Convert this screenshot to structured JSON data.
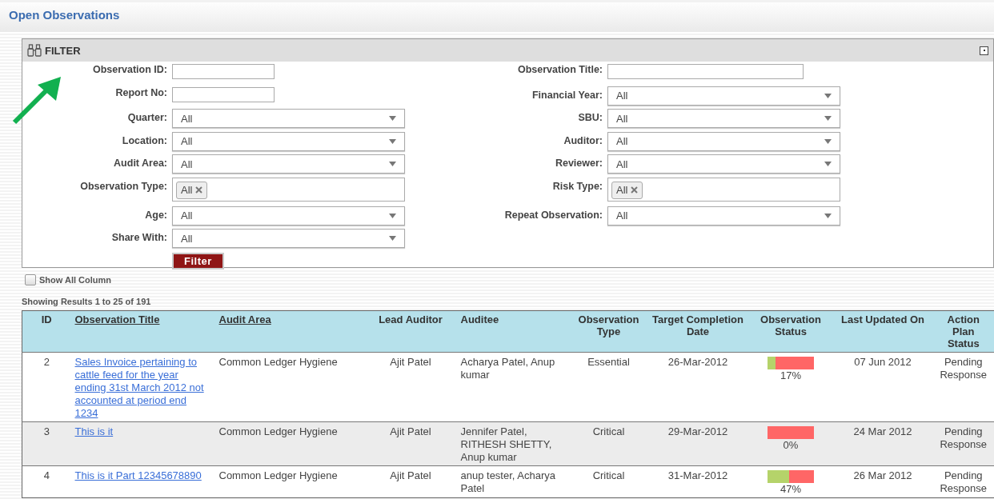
{
  "page": {
    "title": "Open Observations"
  },
  "filter": {
    "title": "FILTER",
    "left_fields": [
      {
        "label": "Observation ID:",
        "kind": "text"
      },
      {
        "label": "Report No:",
        "kind": "text"
      },
      {
        "label": "Quarter:",
        "kind": "select",
        "value": "All"
      },
      {
        "label": "Location:",
        "kind": "select",
        "value": "All"
      },
      {
        "label": "Audit Area:",
        "kind": "select",
        "value": "All"
      },
      {
        "label": "Observation Type:",
        "kind": "tags",
        "tags": [
          "All"
        ]
      },
      {
        "label": "Age:",
        "kind": "select",
        "value": "All"
      },
      {
        "label": "Share With:",
        "kind": "select",
        "value": "All"
      }
    ],
    "right_fields": [
      {
        "label": "Observation Title:",
        "kind": "wide_text"
      },
      {
        "label": "Financial Year:",
        "kind": "select",
        "value": "All"
      },
      {
        "label": "SBU:",
        "kind": "select",
        "value": "All"
      },
      {
        "label": "Auditor:",
        "kind": "select",
        "value": "All"
      },
      {
        "label": "Reviewer:",
        "kind": "select",
        "value": "All"
      },
      {
        "label": "Risk Type:",
        "kind": "tags",
        "tags": [
          "All"
        ]
      },
      {
        "label": "Repeat Observation:",
        "kind": "select",
        "value": "All"
      }
    ],
    "button": "Filter"
  },
  "show_all_column": {
    "label": "Show All Column",
    "checked": false
  },
  "results_summary": "Showing Results 1 to 25 of 191",
  "table": {
    "columns": [
      {
        "label": "ID",
        "sortable": false
      },
      {
        "label": "Observation Title",
        "sortable": true
      },
      {
        "label": "Audit Area",
        "sortable": true
      },
      {
        "label": "Lead Auditor",
        "sortable": false
      },
      {
        "label": "Auditee",
        "sortable": false
      },
      {
        "label": "Observation Type",
        "sortable": false
      },
      {
        "label": "Target Completion Date",
        "sortable": false
      },
      {
        "label": "Observation Status",
        "sortable": false
      },
      {
        "label": "Last Updated On",
        "sortable": false
      },
      {
        "label": "Action Plan Status",
        "sortable": false
      }
    ],
    "rows": [
      {
        "id": "2",
        "title": "Sales Invoice pertaining to cattle feed for the year ending 31st March 2012 not accounted at period end 1234",
        "audit_area": "Common Ledger Hygiene",
        "lead_auditor": "Ajit Patel",
        "auditee": "Acharya Patel, Anup kumar",
        "type": "Essential",
        "target_date": "26-Mar-2012",
        "status": {
          "level": 0.17,
          "reading": "17%"
        },
        "last_updated": "07 Jun 2012",
        "action_plan_status": "Pending Response"
      },
      {
        "id": "3",
        "title": "This is it",
        "audit_area": "Common Ledger Hygiene",
        "lead_auditor": "Ajit Patel",
        "auditee": "Jennifer Patel, RITHESH SHETTY, Anup kumar",
        "type": "Critical",
        "target_date": "29-Mar-2012",
        "status": {
          "level": 0,
          "reading": "0%"
        },
        "last_updated": "24 Mar 2012",
        "action_plan_status": "Pending Response"
      },
      {
        "id": "4",
        "title": "This is it Part 12345678890",
        "audit_area": "Common Ledger Hygiene",
        "lead_auditor": "Ajit Patel",
        "auditee": "anup tester, Acharya Patel",
        "type": "Critical",
        "target_date": "31-Mar-2012",
        "status": {
          "level": 0.47,
          "reading": "47%"
        },
        "last_updated": "26 Mar 2012",
        "action_plan_status": "Pending Response"
      }
    ]
  }
}
